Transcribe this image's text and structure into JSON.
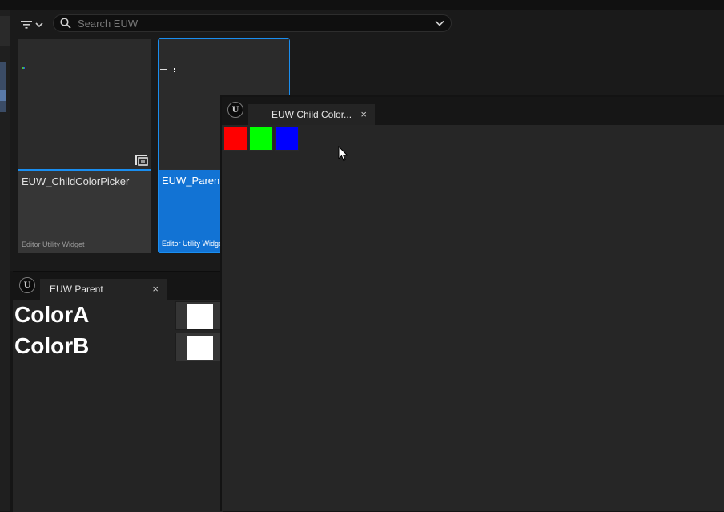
{
  "search": {
    "placeholder": "Search EUW"
  },
  "icons": {
    "filter": "filter-icon",
    "dropdown": "chevron-down-icon",
    "search": "search-icon",
    "engine_logo": "unreal-logo-icon",
    "close": "close-icon",
    "cursor": "mouse-cursor-icon"
  },
  "assets": [
    {
      "name": "EUW_ChildColorPicker",
      "type": "Editor Utility Widget"
    },
    {
      "name": "EUW_Parent",
      "type": "Editor Utility Widget"
    }
  ],
  "parent_panel": {
    "tab_label": "EUW Parent",
    "close_glyph": "×",
    "rows": [
      {
        "label": "ColorA",
        "swatch_color": "#ffffff"
      },
      {
        "label": "ColorB",
        "swatch_color": "#ffffff"
      }
    ]
  },
  "child_window": {
    "tab_label": "EUW Child Color...",
    "close_glyph": "×",
    "colors": [
      "#ff0000",
      "#00ff00",
      "#0000ff"
    ]
  },
  "colors": {
    "accent": "#1a8ef0",
    "selected_tile": "#1273d4"
  }
}
